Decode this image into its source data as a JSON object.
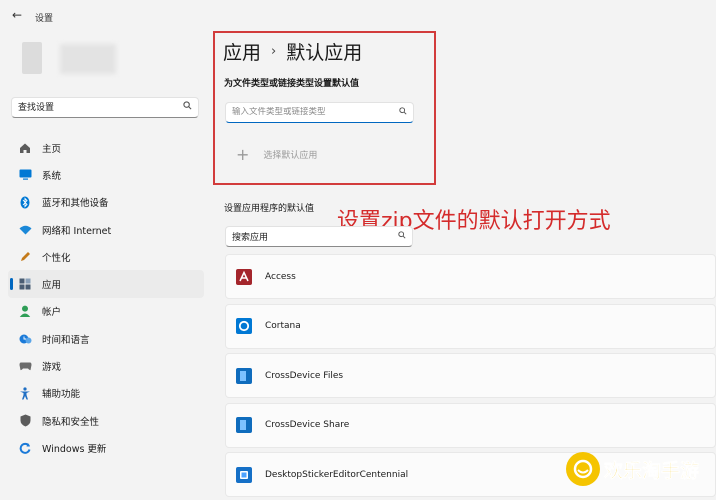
{
  "window": {
    "title": "设置",
    "back_glyph": "←"
  },
  "sidebar": {
    "search": {
      "value": "查找设置"
    },
    "items": [
      {
        "label": "主页",
        "icon": "home-icon",
        "color": "#5b5b5b"
      },
      {
        "label": "系统",
        "icon": "system-icon",
        "color": "#0078d4"
      },
      {
        "label": "蓝牙和其他设备",
        "icon": "bluetooth-icon",
        "color": "#0078d4"
      },
      {
        "label": "网络和 Internet",
        "icon": "network-icon",
        "color": "#1b88d8"
      },
      {
        "label": "个性化",
        "icon": "personalization-icon",
        "color": "#c47a1a"
      },
      {
        "label": "应用",
        "icon": "apps-icon",
        "color": "#4a5d73",
        "active": true
      },
      {
        "label": "帐户",
        "icon": "account-icon",
        "color": "#2f9e57"
      },
      {
        "label": "时间和语言",
        "icon": "time-language-icon",
        "color": "#1b7ad8"
      },
      {
        "label": "游戏",
        "icon": "gaming-icon",
        "color": "#6b6b6b"
      },
      {
        "label": "辅助功能",
        "icon": "accessibility-icon",
        "color": "#1f6fc4"
      },
      {
        "label": "隐私和安全性",
        "icon": "privacy-shield-icon",
        "color": "#5b5b5b"
      },
      {
        "label": "Windows 更新",
        "icon": "windows-update-icon",
        "color": "#1b7ad8"
      }
    ]
  },
  "main": {
    "breadcrumb": {
      "parent": "应用",
      "separator": "›",
      "current": "默认应用"
    },
    "file_type_section": {
      "label": "为文件类型或链接类型设置默认值",
      "search_placeholder": "输入文件类型或链接类型",
      "choose_default_label": "选择默认应用",
      "plus_glyph": "+"
    },
    "app_defaults_section": {
      "label": "设置应用程序的默认值",
      "search_value": "搜索应用"
    },
    "apps": [
      {
        "name": "Access",
        "icon": "access-icon",
        "color": "#a4262c"
      },
      {
        "name": "Cortana",
        "icon": "cortana-icon",
        "color": "#0078d4"
      },
      {
        "name": "CrossDevice Files",
        "icon": "crossdevice-files-icon",
        "color": "#0f6cbd"
      },
      {
        "name": "CrossDevice Share",
        "icon": "crossdevice-share-icon",
        "color": "#0f6cbd"
      },
      {
        "name": "DesktopStickerEditorCentennial",
        "icon": "sticker-editor-icon",
        "color": "#1570c7"
      }
    ]
  },
  "annotation": {
    "text": "设置zip文件的默认打开方式",
    "color": "#d42b2b"
  },
  "watermark": {
    "text": "欢乐淘手游"
  },
  "accent_color": "#0067c0"
}
